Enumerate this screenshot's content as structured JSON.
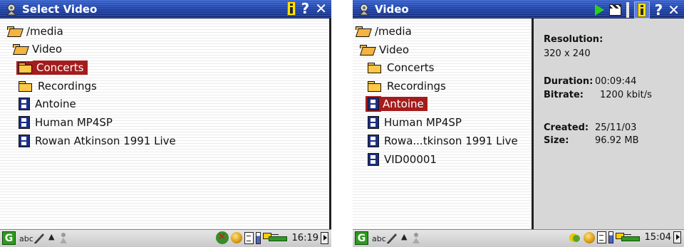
{
  "left": {
    "title": "Select Video",
    "title_buttons": {
      "help": "?",
      "close": "✕"
    },
    "list": [
      {
        "label": "/media",
        "icon": "folder-open-icon",
        "level": 0,
        "selected": false
      },
      {
        "label": "Video",
        "icon": "folder-open-icon",
        "level": 1,
        "selected": false
      },
      {
        "label": "Concerts",
        "icon": "folder-icon",
        "level": 2,
        "selected": true
      },
      {
        "label": "Recordings",
        "icon": "folder-icon",
        "level": 2,
        "selected": false
      },
      {
        "label": "Antoine",
        "icon": "film-icon",
        "level": 2,
        "selected": false
      },
      {
        "label": "Human MP4SP",
        "icon": "film-icon",
        "level": 2,
        "selected": false
      },
      {
        "label": "Rowan Atkinson 1991 Live",
        "icon": "film-icon",
        "level": 2,
        "selected": false
      }
    ],
    "status": {
      "abc": "abc",
      "up": "▲",
      "time": "16:19"
    }
  },
  "right": {
    "title": "Video",
    "title_buttons": {
      "help": "?",
      "close": "✕"
    },
    "list": [
      {
        "label": "/media",
        "icon": "folder-open-icon",
        "level": 0,
        "selected": false
      },
      {
        "label": "Video",
        "icon": "folder-open-icon",
        "level": 1,
        "selected": false
      },
      {
        "label": "Concerts",
        "icon": "folder-icon",
        "level": 2,
        "selected": false
      },
      {
        "label": "Recordings",
        "icon": "folder-icon",
        "level": 2,
        "selected": false
      },
      {
        "label": "Antoine",
        "icon": "film-icon",
        "level": 2,
        "selected": true
      },
      {
        "label": "Human MP4SP",
        "icon": "film-icon",
        "level": 2,
        "selected": false
      },
      {
        "label": "Rowa...tkinson 1991 Live",
        "icon": "film-icon",
        "level": 2,
        "selected": false
      },
      {
        "label": "VID00001",
        "icon": "film-icon",
        "level": 2,
        "selected": false
      }
    ],
    "info": {
      "resolution_label": "Resolution:",
      "resolution_value": "320 x 240",
      "duration_label": "Duration:",
      "duration_value": "00:09:44",
      "bitrate_label": "Bitrate:",
      "bitrate_value": "1200 kbit/s",
      "created_label": "Created:",
      "created_value": "25/11/03",
      "size_label": "Size:",
      "size_value": "96.92 MB"
    },
    "status": {
      "abc": "abc",
      "up": "▲",
      "time": "15:04"
    }
  },
  "colors": {
    "titlebar": "#1c3c9a",
    "selection": "#a41c1c",
    "info_panel": "#d7d7d7"
  }
}
